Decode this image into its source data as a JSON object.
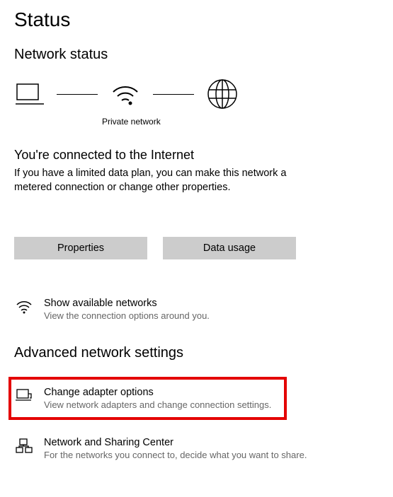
{
  "page_title": "Status",
  "network_status_heading": "Network status",
  "graphic_label": "Private network",
  "connection_title": "You're connected to the Internet",
  "connection_body": "If you have a limited data plan, you can make this network a metered connection or change other properties.",
  "buttons": {
    "properties": "Properties",
    "data_usage": "Data usage"
  },
  "show_networks": {
    "title": "Show available networks",
    "desc": "View the connection options around you."
  },
  "advanced_heading": "Advanced network settings",
  "change_adapter": {
    "title": "Change adapter options",
    "desc": "View network adapters and change connection settings."
  },
  "sharing_center": {
    "title": "Network and Sharing Center",
    "desc": "For the networks you connect to, decide what you want to share."
  }
}
